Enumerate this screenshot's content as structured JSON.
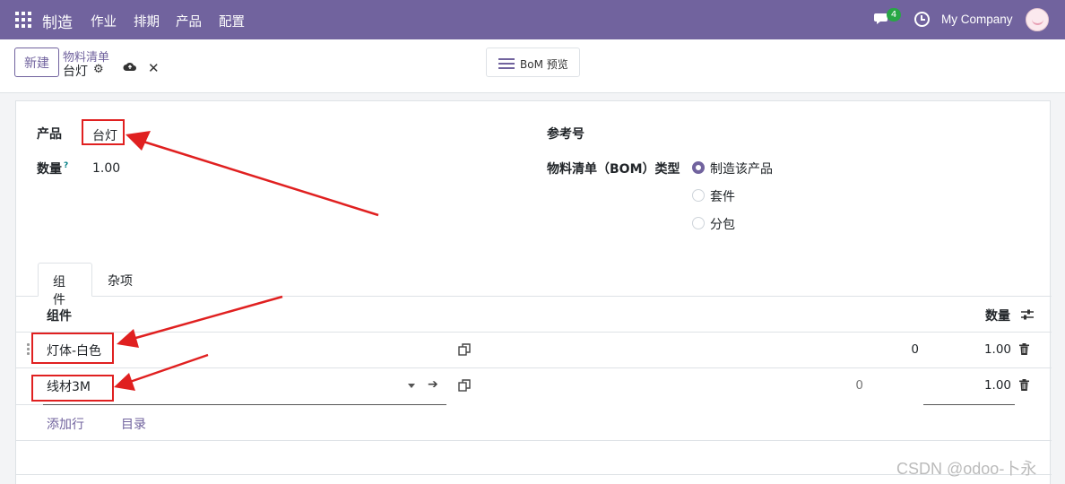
{
  "navbar": {
    "app_name": "制造",
    "menu": [
      "作业",
      "排期",
      "产品",
      "配置"
    ],
    "chat_badge": "4",
    "company": "My Company"
  },
  "control": {
    "new_label": "新建",
    "breadcrumb_parent": "物料清单",
    "breadcrumb_current": "台灯",
    "bom_preview_label": "BoM 预览"
  },
  "form": {
    "product_label": "产品",
    "product_value": "台灯",
    "quantity_label": "数量",
    "quantity_help": "?",
    "quantity_value": "1.00",
    "reference_label": "参考号",
    "bom_type_label": "物料清单（BOM）类型",
    "bom_type_options": [
      {
        "label": "制造该产品",
        "selected": true
      },
      {
        "label": "套件",
        "selected": false
      },
      {
        "label": "分包",
        "selected": false
      }
    ]
  },
  "tabs": [
    {
      "label": "组件",
      "active": true
    },
    {
      "label": "杂项",
      "active": false
    }
  ],
  "components": {
    "header_component": "组件",
    "header_quantity": "数量",
    "rows": [
      {
        "name": "灯体-白色",
        "col_a": "0",
        "quantity": "1.00"
      },
      {
        "name": "线材3M",
        "col_a": "0",
        "quantity": "1.00"
      }
    ],
    "add_line": "添加行",
    "catalog": "目录"
  },
  "watermark": "CSDN @odoo-卜永"
}
